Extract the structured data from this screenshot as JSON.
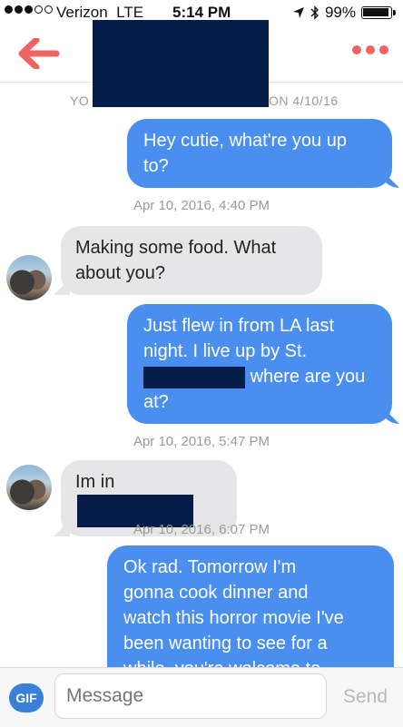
{
  "status_bar": {
    "carrier": "Verizon",
    "network": "LTE",
    "time": "5:14 PM",
    "battery": "99%"
  },
  "header": {
    "back_icon": "back-arrow-icon",
    "more_icon": "more-dots-icon",
    "accent_color": "#f06363"
  },
  "match_line": {
    "prefix": "YO",
    "suffix": "ON 4/10/16"
  },
  "messages": [
    {
      "side": "out",
      "text": "Hey cutie, what're you up to?"
    },
    {
      "side": "timestamp",
      "text": "Apr 10, 2016, 4:40 PM"
    },
    {
      "side": "in",
      "text": "Making some food. What about you?"
    },
    {
      "side": "out",
      "line1": "Just flew in from LA last",
      "line2": "night. I live up by St.",
      "line3_after": "where are you",
      "line4": "at?"
    },
    {
      "side": "timestamp",
      "text": "Apr 10, 2016, 5:47 PM"
    },
    {
      "side": "in",
      "text": "Im in"
    },
    {
      "side": "timestamp",
      "text": "Apr 10, 2016, 6:07 PM"
    },
    {
      "side": "out",
      "lines": [
        "Ok rad. Tomorrow I'm",
        "gonna cook dinner and",
        "watch this horror movie I've",
        "been wanting to see for a",
        "while, you're welcome to"
      ]
    }
  ],
  "input_bar": {
    "gif_label": "GIF",
    "placeholder": "Message",
    "send_label": "Send"
  },
  "colors": {
    "outgoing_bubble": "#4a8ef0",
    "incoming_bubble": "#e6e6e8",
    "redaction": "#071d49"
  }
}
